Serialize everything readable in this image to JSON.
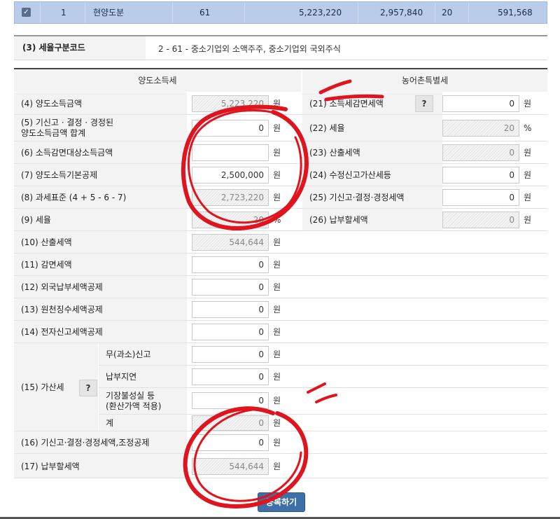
{
  "top_row": {
    "checked": true,
    "no": "1",
    "type": "현양도분",
    "code": "61",
    "amount1": "5,223,220",
    "amount2": "2,957,840",
    "rate": "20",
    "amount3": "591,568"
  },
  "code_row": {
    "label": "(3) 세율구분코드",
    "value": "2  -  61  -  중소기업외 소액주주, 중소기업외 국외주식"
  },
  "headers": {
    "left": "양도소득세",
    "right": "농어촌특별세"
  },
  "left_rows": [
    {
      "label": "(4) 양도소득금액",
      "value": "5,223,220",
      "unit": "원"
    },
    {
      "label_line1": "(5) 기신고 · 결정 · 경정된",
      "label_line2": "양도소득금액 합계",
      "value": "0",
      "unit": "원"
    },
    {
      "label": "(6) 소득감면대상소득금액",
      "value": "",
      "unit": "원"
    },
    {
      "label": "(7) 양도소득기본공제",
      "value": "2,500,000",
      "unit": "원"
    },
    {
      "label": "(8) 과세표준 (4 + 5 - 6 - 7)",
      "value": "2,723,220",
      "unit": "원"
    },
    {
      "label": "(9) 세율",
      "value": "20",
      "unit": "%"
    },
    {
      "label": "(10) 산출세액",
      "value": "544,644",
      "unit": "원"
    },
    {
      "label": "(11) 감면세액",
      "value": "0",
      "unit": "원"
    },
    {
      "label": "(12) 외국납부세액공제",
      "value": "0",
      "unit": "원"
    },
    {
      "label": "(13) 원천징수세액공제",
      "value": "0",
      "unit": "원"
    },
    {
      "label": "(14) 전자신고세액공제",
      "value": "0",
      "unit": "원"
    }
  ],
  "penalty": {
    "label": "(15) 가산세",
    "help": "?",
    "subs": [
      {
        "label": "무(과소)신고",
        "value": "0",
        "unit": "원"
      },
      {
        "label": "납부지연",
        "value": "0",
        "unit": "원"
      },
      {
        "label_line1": "기장불성실 등",
        "label_line2": "(환산가액 적용)",
        "value": "0",
        "unit": "원"
      },
      {
        "label": "계",
        "value": "0",
        "unit": "원"
      }
    ]
  },
  "bottom_rows": [
    {
      "label": "(16) 기신고·결정·경정세액,조정공제",
      "value": "0",
      "unit": "원"
    },
    {
      "label": "(17) 납부할세액",
      "value": "544,644",
      "unit": "원"
    }
  ],
  "right_rows": [
    {
      "label": "(21) 소득세감면세액",
      "help": "?",
      "value": "0",
      "unit": "원"
    },
    {
      "label": "(22) 세율",
      "value": "20",
      "unit": "%"
    },
    {
      "label": "(23) 산출세액",
      "value": "0",
      "unit": "원"
    },
    {
      "label": "(24) 수정신고가산세등",
      "value": "0",
      "unit": "원"
    },
    {
      "label": "(25) 기신고·결정·경정세액",
      "value": "0",
      "unit": "원"
    },
    {
      "label": "(26) 납부할세액",
      "value": "0",
      "unit": "원"
    }
  ],
  "submit_label": "등록하기",
  "icons": {
    "checkbox": "checkbox-checked-icon",
    "annotation": "red-circle-marks"
  },
  "colors": {
    "selected_row": "#b9cdea",
    "label_bg": "#f3f3f3",
    "button": "#3d6fa8",
    "annotation": "#e0141e"
  }
}
